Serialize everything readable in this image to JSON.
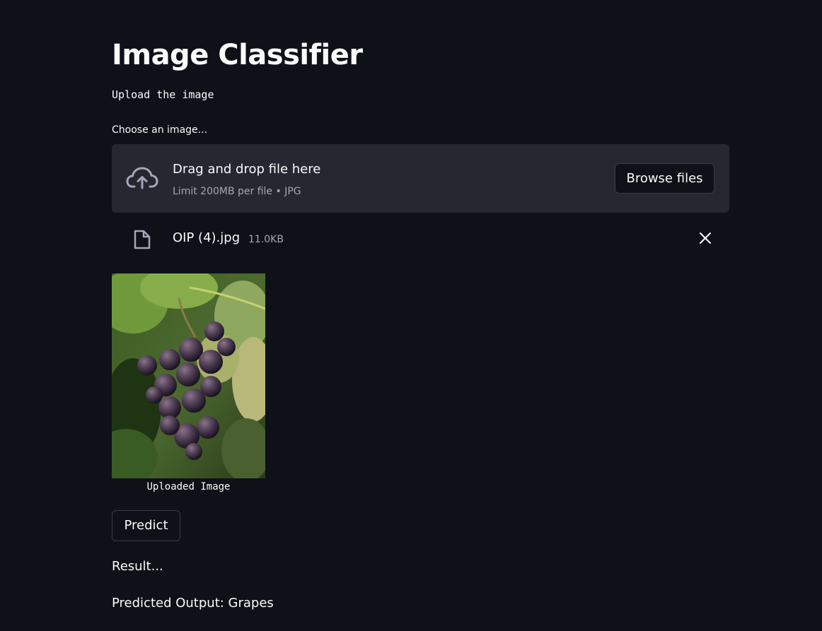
{
  "page": {
    "title": "Image Classifier",
    "subtitle": "Upload the image"
  },
  "uploader": {
    "label": "Choose an image...",
    "drop_text": "Drag and drop file here",
    "limit_text": "Limit 200MB per file • JPG",
    "browse_label": "Browse files",
    "icon": "cloud-upload-icon"
  },
  "file": {
    "name": "OIP (4).jpg",
    "size": "11.0KB",
    "icon": "file-icon",
    "remove_icon": "close-icon"
  },
  "image": {
    "caption": "Uploaded Image"
  },
  "actions": {
    "predict_label": "Predict"
  },
  "results": {
    "result_text": "Result...",
    "output_text": "Predicted Output: Grapes"
  },
  "colors": {
    "background": "#0e1117",
    "dropzone": "#262730",
    "text": "#fafafa",
    "muted_text": "#a3a8b8",
    "button_border": "#3a3d48"
  }
}
